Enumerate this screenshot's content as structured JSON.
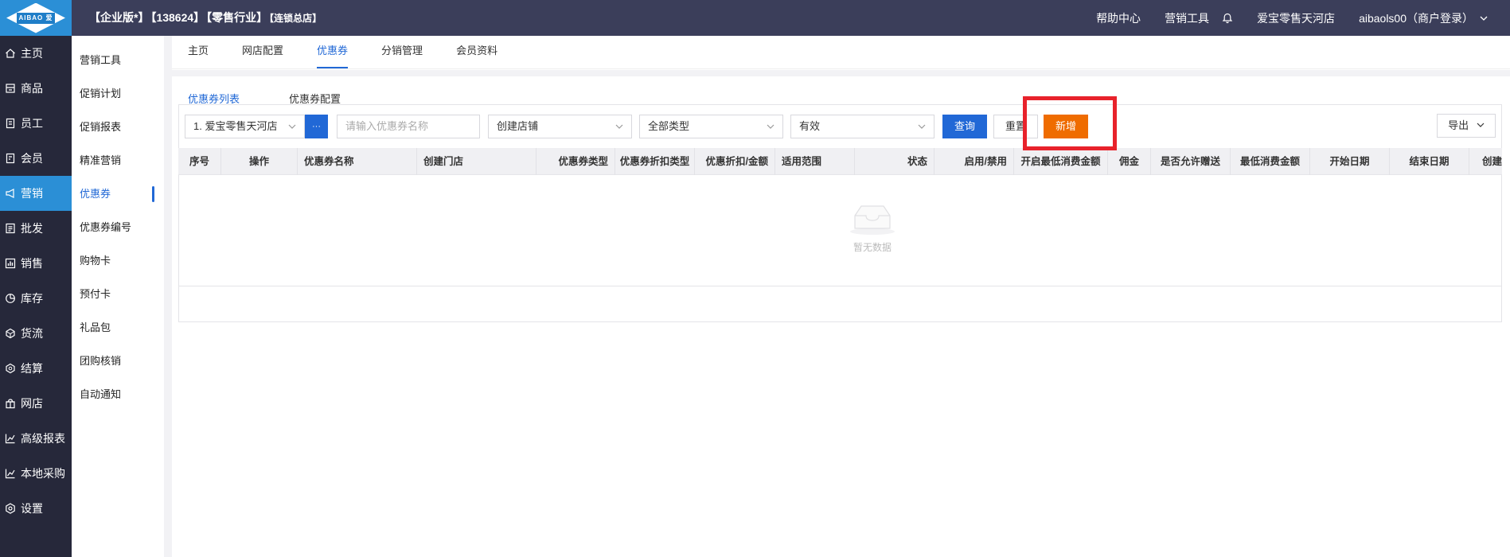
{
  "header": {
    "logo_text": "AIBAO 爱宝",
    "edition": "【企业版*】",
    "account_id": "【138624】",
    "industry": "【零售行业】",
    "store_type": "【连锁总店】",
    "help_center": "帮助中心",
    "marketing_tools": "营销工具",
    "store_name": "爱宝零售天河店",
    "user": "aibaols00（商户登录）"
  },
  "leftnav": {
    "items": [
      {
        "label": "主页",
        "icon": "home-icon"
      },
      {
        "label": "商品",
        "icon": "goods-icon"
      },
      {
        "label": "员工",
        "icon": "staff-icon"
      },
      {
        "label": "会员",
        "icon": "member-icon"
      },
      {
        "label": "营销",
        "icon": "megaphone-icon",
        "active": true
      },
      {
        "label": "批发",
        "icon": "wholesale-icon"
      },
      {
        "label": "销售",
        "icon": "sales-icon"
      },
      {
        "label": "库存",
        "icon": "inventory-icon"
      },
      {
        "label": "货流",
        "icon": "logistics-icon"
      },
      {
        "label": "结算",
        "icon": "settlement-icon"
      },
      {
        "label": "网店",
        "icon": "shop-icon"
      },
      {
        "label": "高级报表",
        "icon": "chart-icon"
      },
      {
        "label": "本地采购",
        "icon": "purchase-icon"
      },
      {
        "label": "设置",
        "icon": "settings-icon"
      }
    ]
  },
  "subnav": {
    "items": [
      {
        "label": "营销工具"
      },
      {
        "label": "促销计划"
      },
      {
        "label": "促销报表"
      },
      {
        "label": "精准营销"
      },
      {
        "label": "优惠券",
        "active": true
      },
      {
        "label": "优惠券编号"
      },
      {
        "label": "购物卡"
      },
      {
        "label": "预付卡"
      },
      {
        "label": "礼品包"
      },
      {
        "label": "团购核销"
      },
      {
        "label": "自动通知"
      }
    ]
  },
  "tabs": [
    {
      "label": "主页"
    },
    {
      "label": "网店配置"
    },
    {
      "label": "优惠券",
      "active": true
    },
    {
      "label": "分销管理"
    },
    {
      "label": "会员资料"
    }
  ],
  "subtabs": {
    "list": "优惠券列表",
    "config": "优惠券配置"
  },
  "filters": {
    "store_select": "1. 爱宝零售天河店",
    "more_button": "···",
    "coupon_name_placeholder": "请输入优惠券名称",
    "create_store_select": "创建店铺",
    "type_select": "全部类型",
    "status_select": "有效",
    "query_button": "查询",
    "reset_button": "重置",
    "add_button": "新增",
    "export_button": "导出"
  },
  "table": {
    "columns": [
      "序号",
      "操作",
      "优惠券名称",
      "创建门店",
      "优惠券类型",
      "优惠券折扣类型",
      "优惠折扣/金额",
      "适用范围",
      "状态",
      "启用/禁用",
      "开启最低消费金额",
      "佣金",
      "是否允许赠送",
      "最低消费金额",
      "开始日期",
      "结束日期",
      "创建"
    ],
    "empty_text": "暂无数据"
  },
  "colors": {
    "topbar": "#3b3e5a",
    "leftnav": "#26283a",
    "accent": "#2168d6",
    "add_button": "#ef6c00",
    "highlight": "#e8222b"
  }
}
